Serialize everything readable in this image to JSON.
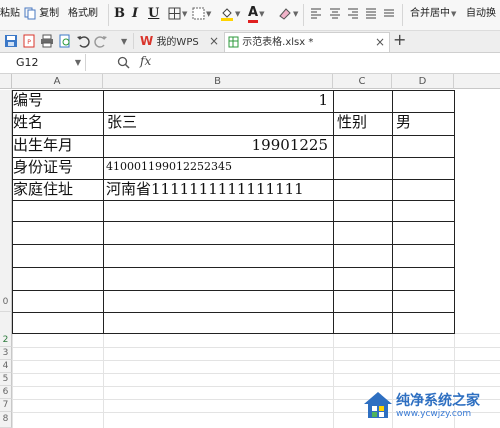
{
  "ribbon": {
    "paste_label": "粘贴",
    "copy_label": "复制",
    "format_painter_label": "格式刷",
    "bold": "B",
    "italic": "I",
    "underline": "U",
    "font_color_glyph": "A",
    "merge_label": "合并居中",
    "autowrap_label": "自动换"
  },
  "tabs": [
    {
      "label": "我的WPS",
      "active": false
    },
    {
      "label": "示范表格.xlsx *",
      "active": true
    }
  ],
  "formula_bar": {
    "cell_ref": "G12",
    "fx": "fx"
  },
  "columns": [
    "A",
    "B",
    "C",
    "D"
  ],
  "rows": [
    {
      "a": "编号",
      "b": "1",
      "c": "",
      "d": ""
    },
    {
      "a": "姓名",
      "b": "张三",
      "c": "性别",
      "d": "男"
    },
    {
      "a": "出生年月",
      "b": "19901225",
      "c": "",
      "d": ""
    },
    {
      "a": "身份证号",
      "b": "410001199012252345",
      "c": "",
      "d": ""
    },
    {
      "a": "家庭住址",
      "b": "河南省1111111111111111",
      "c": "",
      "d": ""
    }
  ],
  "row_numbers": [
    "0",
    "2",
    "3",
    "4",
    "5",
    "6",
    "7",
    "8"
  ],
  "colors": {
    "wps_red": "#d9342b",
    "font_red": "#e02020",
    "highlight_yellow": "#ffd400",
    "watermark_blue": "#2e6fc1"
  },
  "watermark": {
    "title": "纯净系统之家",
    "url": "www.ycwjzy.com"
  }
}
